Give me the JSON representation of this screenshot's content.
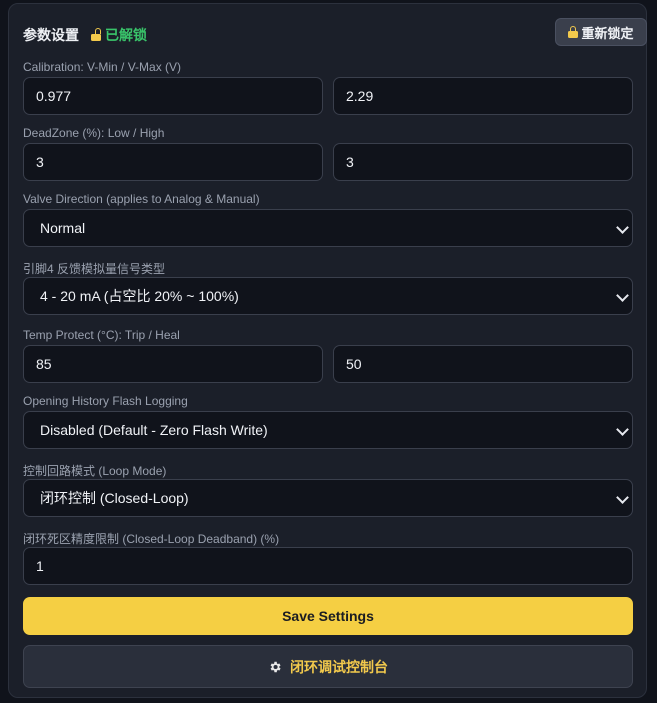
{
  "header": {
    "title": "参数设置",
    "lock_status": "已解锁",
    "relock_label": "重新锁定"
  },
  "calibration": {
    "label": "Calibration: V-Min / V-Max (V)",
    "vmin": "0.977",
    "vmax": "2.29"
  },
  "deadzone": {
    "label": "DeadZone (%): Low / High",
    "low": "3",
    "high": "3"
  },
  "valve_direction": {
    "label": "Valve Direction (applies to Analog & Manual)",
    "selected": "Normal"
  },
  "pin4_feedback": {
    "label": "引脚4 反馈模拟量信号类型",
    "selected": "4 - 20 mA (占空比 20% ~ 100%)"
  },
  "temp_protect": {
    "label": "Temp Protect (°C): Trip / Heal",
    "trip": "85",
    "heal": "50"
  },
  "flash_logging": {
    "label": "Opening History Flash Logging",
    "selected": "Disabled (Default - Zero Flash Write)"
  },
  "loop_mode": {
    "label": "控制回路模式 (Loop Mode)",
    "selected": "闭环控制 (Closed-Loop)"
  },
  "deadband": {
    "label": "闭环死区精度限制 (Closed-Loop Deadband) (%)",
    "value": "1"
  },
  "actions": {
    "save_label": "Save Settings",
    "console_label": "闭环调试控制台"
  },
  "colors": {
    "accent": "#f5cf43",
    "unlocked": "#39c46a",
    "panel": "#1b1f29",
    "input_bg": "#10131b"
  },
  "icons": {
    "lock_status": "unlocked-padlock-icon",
    "relock": "padlock-icon",
    "console": "gear-icon"
  }
}
